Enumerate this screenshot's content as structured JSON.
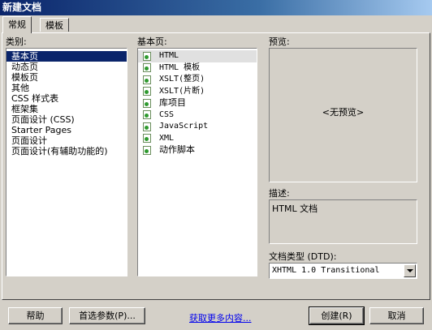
{
  "window": {
    "title": "新建文档"
  },
  "tabs": [
    {
      "label": "常规",
      "active": true
    },
    {
      "label": "模板",
      "active": false
    }
  ],
  "category": {
    "label": "类别:",
    "items": [
      "基本页",
      "动态页",
      "模板页",
      "其他",
      "CSS 样式表",
      "框架集",
      "页面设计 (CSS)",
      "Starter Pages",
      "页面设计",
      "页面设计(有辅助功能的)"
    ],
    "selected": "基本页"
  },
  "basic_page": {
    "label": "基本页:",
    "items": [
      "HTML",
      "HTML 模板",
      "XSLT(整页)",
      "XSLT(片断)",
      "库项目",
      "CSS",
      "JavaScript",
      "XML",
      "动作脚本"
    ],
    "selected": "HTML",
    "icon": "document-icon"
  },
  "preview": {
    "label": "预览:",
    "placeholder": "<无预览>"
  },
  "description": {
    "label": "描述:",
    "text": "HTML 文档"
  },
  "doctype": {
    "label": "文档类型 (DTD):",
    "value": "XHTML 1.0 Transitional"
  },
  "buttons": {
    "help": "帮助",
    "preferences": "首选参数(P)...",
    "get_more": "获取更多内容...",
    "create": "创建(R)",
    "cancel": "取消"
  },
  "colors": {
    "selection": "#0a246a",
    "face": "#d4d0c8",
    "link": "#0000ee"
  }
}
